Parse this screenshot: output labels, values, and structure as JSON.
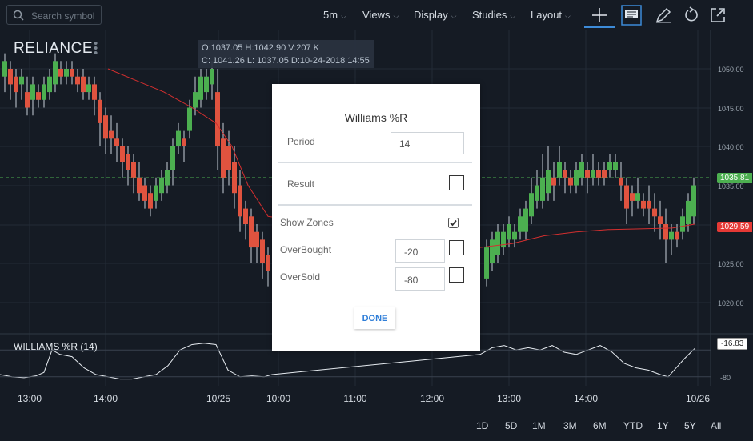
{
  "toolbar": {
    "search_placeholder": "Search symbol",
    "interval": "5m",
    "views": "Views",
    "display": "Display",
    "studies": "Studies",
    "layout": "Layout"
  },
  "symbol": "RELIANCE",
  "ohlc": {
    "line1": "O:1037.05  H:1042.90  V:207 K",
    "line2": "C: 1041.26  L: 1037.05  D:10-24-2018 14:55"
  },
  "price_axis": [
    "1050.00",
    "1045.00",
    "1040.00",
    "1035.00",
    "1030.00",
    "1025.00",
    "1020.00"
  ],
  "last_price": "1035.81",
  "ma_price": "1029.59",
  "time_axis": [
    "13:00",
    "14:00",
    "10/25",
    "10:00",
    "11:00",
    "12:00",
    "13:00",
    "14:00",
    "10/26"
  ],
  "study": {
    "label": "WILLIAMS %R (14)",
    "value": "-16.83",
    "level": "-80"
  },
  "dialog": {
    "title": "Williams %R",
    "period_label": "Period",
    "period_value": "14",
    "result_label": "Result",
    "show_zones_label": "Show Zones",
    "show_zones_checked": true,
    "overbought_label": "OverBought",
    "overbought_value": "-20",
    "oversold_label": "OverSold",
    "oversold_value": "-80",
    "done_label": "DONE"
  },
  "ranges": [
    "1D",
    "5D",
    "1M",
    "3M",
    "6M",
    "YTD",
    "1Y",
    "5Y",
    "All"
  ],
  "colors": {
    "background": "#151b24",
    "up": "#4caf50",
    "down": "#e0533f",
    "ma_line": "#d32f2f",
    "accent": "#3d8bd8"
  }
}
